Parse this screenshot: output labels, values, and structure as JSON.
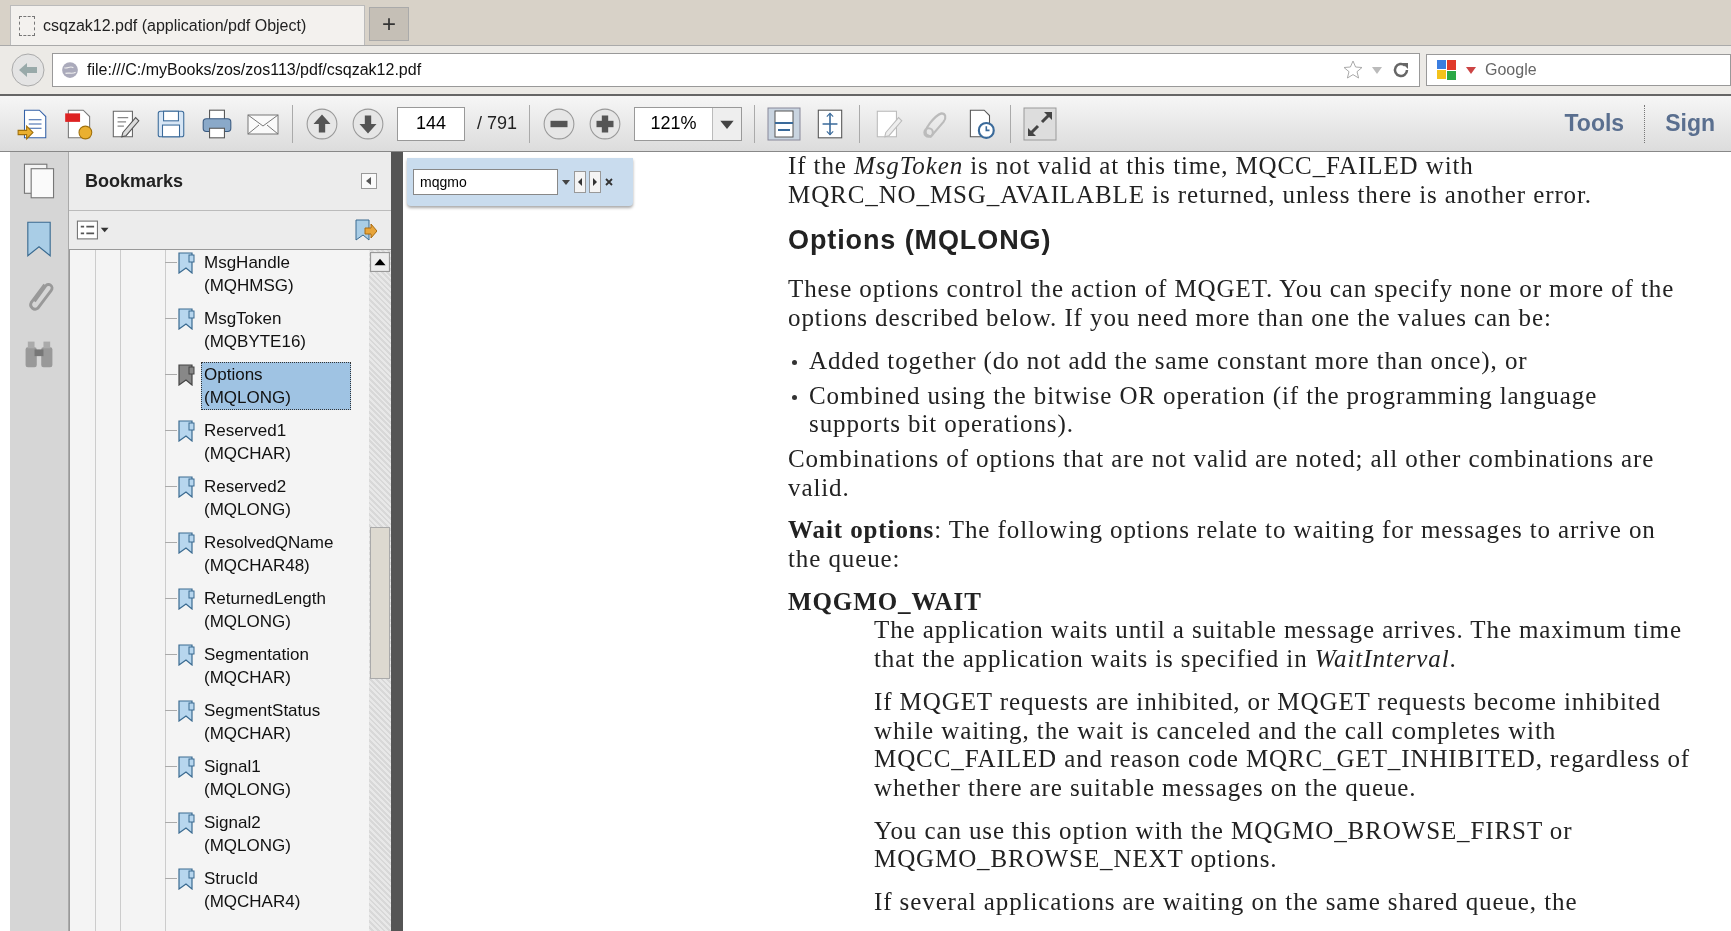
{
  "browser_tab": {
    "title": "csqzak12.pdf (application/pdf Object)",
    "new_tab": "+"
  },
  "address_bar": {
    "url": "file:///C:/myBooks/zos/zos113/pdf/csqzak12.pdf"
  },
  "search_bar": {
    "placeholder": "Google"
  },
  "toolbar": {
    "page": "144",
    "page_total": "/ 791",
    "zoom": "121%",
    "links": [
      "Tools",
      "Sign"
    ]
  },
  "side_panel": {
    "title": "Bookmarks",
    "bookmarks": [
      {
        "name": "MsgHandle",
        "type": "(MQHMSG)",
        "selected": false
      },
      {
        "name": "MsgToken",
        "type": "(MQBYTE16)",
        "selected": false
      },
      {
        "name": "Options",
        "type": "(MQLONG)",
        "selected": true
      },
      {
        "name": "Reserved1",
        "type": "(MQCHAR)",
        "selected": false
      },
      {
        "name": "Reserved2",
        "type": "(MQLONG)",
        "selected": false
      },
      {
        "name": "ResolvedQName",
        "type": "(MQCHAR48)",
        "selected": false
      },
      {
        "name": "ReturnedLength",
        "type": "(MQLONG)",
        "selected": false
      },
      {
        "name": "Segmentation",
        "type": "(MQCHAR)",
        "selected": false
      },
      {
        "name": "SegmentStatus",
        "type": "(MQCHAR)",
        "selected": false
      },
      {
        "name": "Signal1",
        "type": "(MQLONG)",
        "selected": false
      },
      {
        "name": "Signal2",
        "type": "(MQLONG)",
        "selected": false
      },
      {
        "name": "StrucId",
        "type": "(MQCHAR4)",
        "selected": false
      }
    ]
  },
  "find_bar": {
    "value": "mqgmo"
  },
  "document": [
    {
      "kind": "para",
      "text": "If the *MsgToken* is not valid at this time, MQCC_FAILED with MQRC_NO_MSG_AVAILABLE is returned, unless there is another error."
    },
    {
      "kind": "heading",
      "text": "Options (MQLONG)"
    },
    {
      "kind": "para",
      "text": "These options control the action of MQGET. You can specify none or more of the options described below. If you need more than one the values can be:"
    },
    {
      "kind": "bullet",
      "text": "Added together (do not add the same constant more than once), or"
    },
    {
      "kind": "bullet",
      "text": "Combined using the bitwise OR operation (if the programming language supports bit operations)."
    },
    {
      "kind": "para",
      "text": "Combinations of options that are not valid are noted; all other combinations are valid."
    },
    {
      "kind": "para",
      "text": "**Wait options**: The following options relate to waiting for messages to arrive on the queue:"
    },
    {
      "kind": "term",
      "text": "MQGMO_WAIT"
    },
    {
      "kind": "indent",
      "text": "The application waits until a suitable message arrives. The maximum time that the application waits is specified in *WaitInterval*."
    },
    {
      "kind": "indent",
      "text": "If MQGET requests are inhibited, or MQGET requests become inhibited while waiting, the wait is canceled and the call completes with MQCC_FAILED and reason code MQRC_GET_INHIBITED, regardless of whether there are suitable messages on the queue."
    },
    {
      "kind": "indent",
      "text": "You can use this option with the MQGMO_BROWSE_FIRST or MQGMO_BROWSE_NEXT options."
    },
    {
      "kind": "indent",
      "text": "If several applications are waiting on the same shared queue, the"
    }
  ]
}
